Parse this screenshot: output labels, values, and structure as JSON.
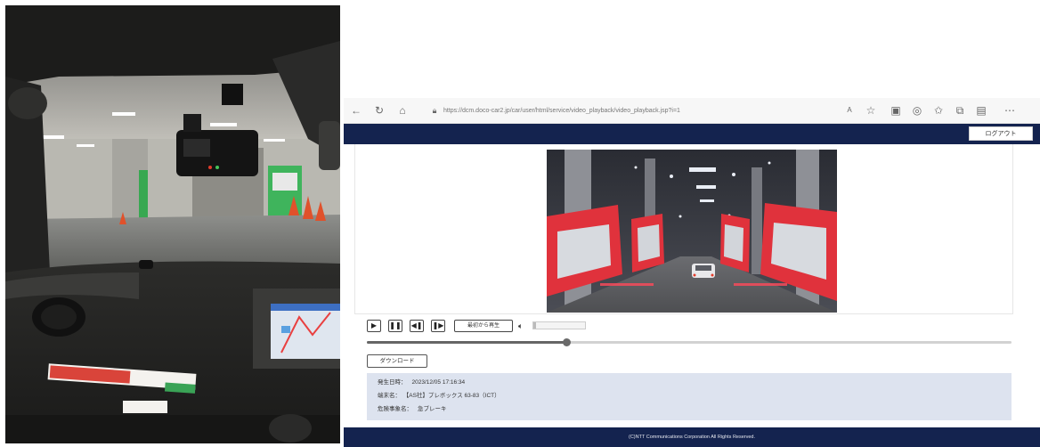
{
  "browser": {
    "url": "https://dcm.doco-car2.jp/car/user/html/service/video_playback/video_playback.jsp?i=1",
    "icons": [
      "back-icon",
      "reload-icon",
      "home-icon",
      "lock-icon",
      "read-aloud-icon",
      "favorite-star-icon",
      "extension-icon",
      "profile-icon",
      "favorites-icon",
      "collections-icon",
      "wallet-icon",
      "more-icon"
    ]
  },
  "header": {
    "logout_label": "ログアウト"
  },
  "player": {
    "replay_label": "最初から再生",
    "volume_fraction": 0.05,
    "seek_fraction": 0.31
  },
  "download": {
    "label": "ダウンロード"
  },
  "info": {
    "time_label": "発生日時：",
    "time_value": "2023/12/05 17:16:34",
    "vehicle_label": "端末名：",
    "vehicle_value": "【AS社】プレボックス 63-83（ICT）",
    "event_label": "危険事象名：",
    "event_value": "急ブレーキ"
  },
  "footer": {
    "copyright": "(C)NTT Communications Corporation All Rights Reserved."
  },
  "colors": {
    "header_navy": "#14234f",
    "info_panel": "#dde3ef",
    "booth_red": "#e0323c"
  }
}
